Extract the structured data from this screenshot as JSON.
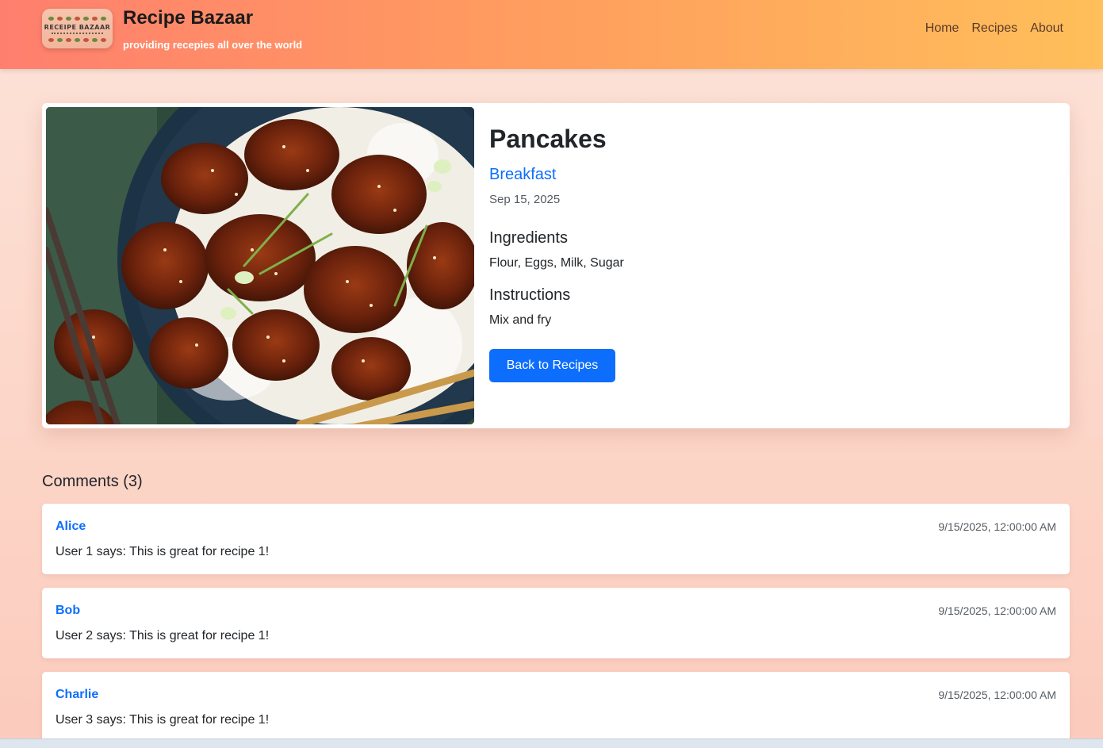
{
  "header": {
    "logo_text": "RECEIPE BAZAAR",
    "title": "Recipe Bazaar",
    "subtitle": "providing recepies all over the world",
    "nav": [
      {
        "label": "Home"
      },
      {
        "label": "Recipes"
      },
      {
        "label": "About"
      }
    ]
  },
  "recipe": {
    "image_icon": "food-photo",
    "title": "Pancakes",
    "category": "Breakfast",
    "date": "Sep 15, 2025",
    "ingredients_heading": "Ingredients",
    "ingredients": "Flour, Eggs, Milk, Sugar",
    "instructions_heading": "Instructions",
    "instructions": "Mix and fry",
    "back_button": "Back to Recipes"
  },
  "comments": {
    "heading": "Comments (3)",
    "items": [
      {
        "author": "Alice",
        "time": "9/15/2025, 12:00:00 AM",
        "text": "User 1 says: This is great for recipe 1!"
      },
      {
        "author": "Bob",
        "time": "9/15/2025, 12:00:00 AM",
        "text": "User 2 says: This is great for recipe 1!"
      },
      {
        "author": "Charlie",
        "time": "9/15/2025, 12:00:00 AM",
        "text": "User 3 says: This is great for recipe 1!"
      }
    ]
  },
  "colors": {
    "accent": "#0d6efd",
    "header_start": "#ff7f6e",
    "header_end": "#ffbf5a"
  }
}
